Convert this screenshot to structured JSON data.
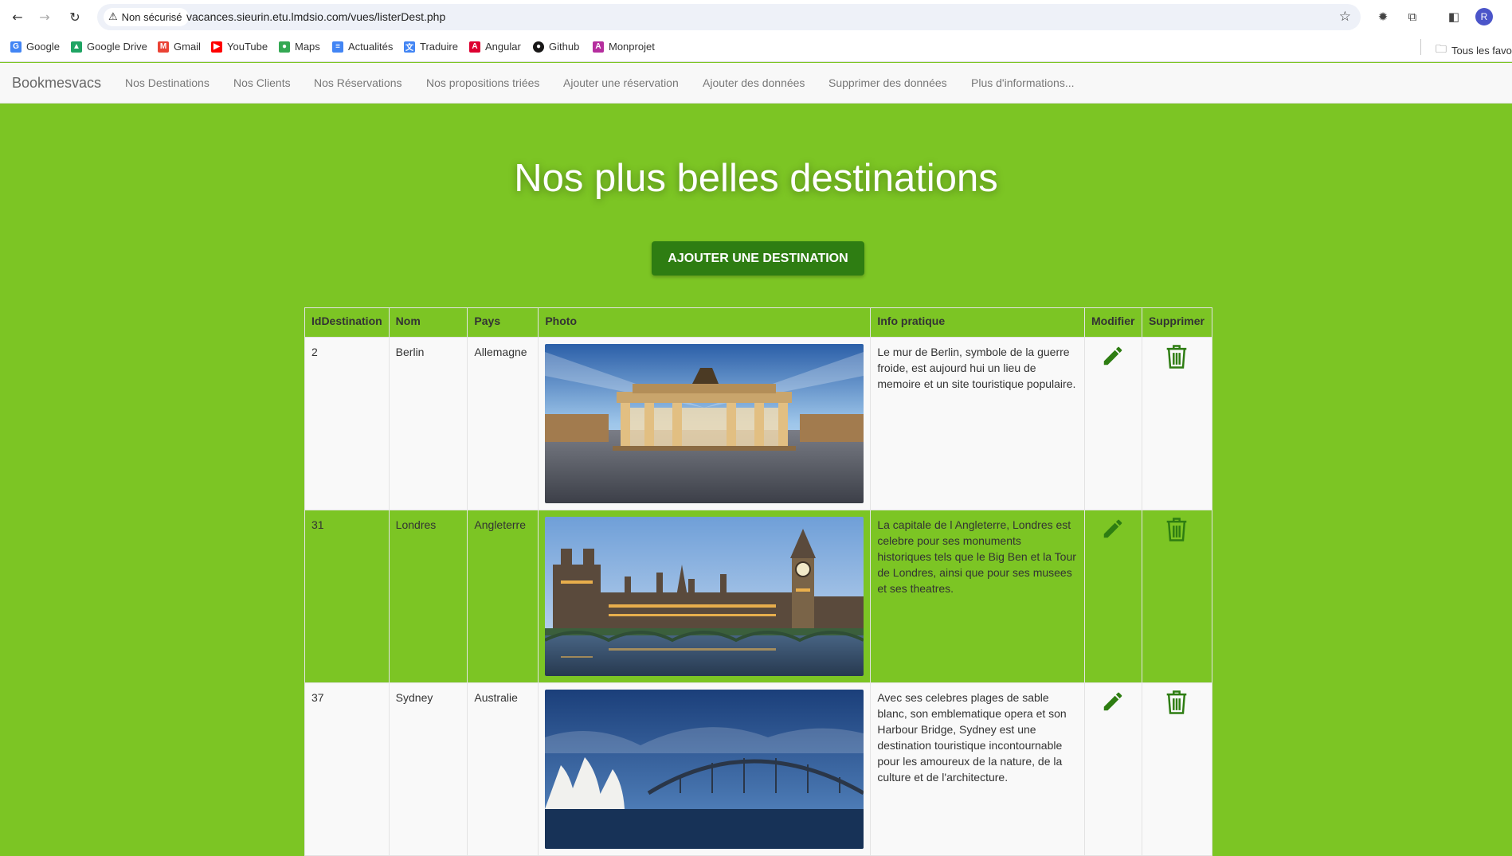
{
  "browser": {
    "security_label": "Non sécurisé",
    "url": "vacances.sieurin.etu.lmdsio.com/vues/listerDest.php",
    "profile_initial": "R",
    "bookmarks": [
      {
        "label": "Google",
        "icon": "google-icon",
        "color": "#4285f4"
      },
      {
        "label": "Google Drive",
        "icon": "drive-icon",
        "color": "#1fa463"
      },
      {
        "label": "Gmail",
        "icon": "gmail-icon",
        "color": "#ea4335"
      },
      {
        "label": "YouTube",
        "icon": "youtube-icon",
        "color": "#ff0000"
      },
      {
        "label": "Maps",
        "icon": "maps-icon",
        "color": "#34a853"
      },
      {
        "label": "Actualités",
        "icon": "news-icon",
        "color": "#4285f4"
      },
      {
        "label": "Traduire",
        "icon": "translate-icon",
        "color": "#4285f4"
      },
      {
        "label": "Angular",
        "icon": "angular-icon",
        "color": "#dd0031"
      },
      {
        "label": "Github",
        "icon": "github-icon",
        "color": "#181717"
      },
      {
        "label": "Monprojet",
        "icon": "angular-icon",
        "color": "#b52e9e"
      }
    ],
    "all_bookmarks_label": "Tous les favoris"
  },
  "nav": {
    "brand": "Bookmesvacs",
    "links": [
      "Nos Destinations",
      "Nos Clients",
      "Nos Réservations",
      "Nos propositions triées",
      "Ajouter une réservation",
      "Ajouter des données",
      "Supprimer des données",
      "Plus d'informations..."
    ]
  },
  "main": {
    "title": "Nos plus belles destinations",
    "add_button": "AJOUTER UNE DESTINATION"
  },
  "table": {
    "headers": [
      "IdDestination",
      "Nom",
      "Pays",
      "Photo",
      "Info pratique",
      "Modifier",
      "Supprimer"
    ],
    "rows": [
      {
        "id": "2",
        "nom": "Berlin",
        "pays": "Allemagne",
        "photo": "brandenburg-gate-photo",
        "info": "Le mur de Berlin, symbole de la guerre froide, est aujourd hui un lieu de memoire et un site touristique populaire."
      },
      {
        "id": "31",
        "nom": "Londres",
        "pays": "Angleterre",
        "photo": "westminster-photo",
        "info": "La capitale de l Angleterre, Londres est celebre pour ses monuments historiques tels que le Big Ben et la Tour de Londres, ainsi que pour ses musees et ses theatres."
      },
      {
        "id": "37",
        "nom": "Sydney",
        "pays": "Australie",
        "photo": "sydney-opera-photo",
        "info": "Avec ses celebres plages de sable blanc, son emblematique opera et son Harbour Bridge, Sydney est une destination touristique incontournable pour les amoureux de la nature, de la culture et de l'architecture."
      }
    ]
  },
  "colors": {
    "page_bg": "#7cc524",
    "button_bg": "#2e7d12",
    "icon_green": "#2e7d12"
  }
}
